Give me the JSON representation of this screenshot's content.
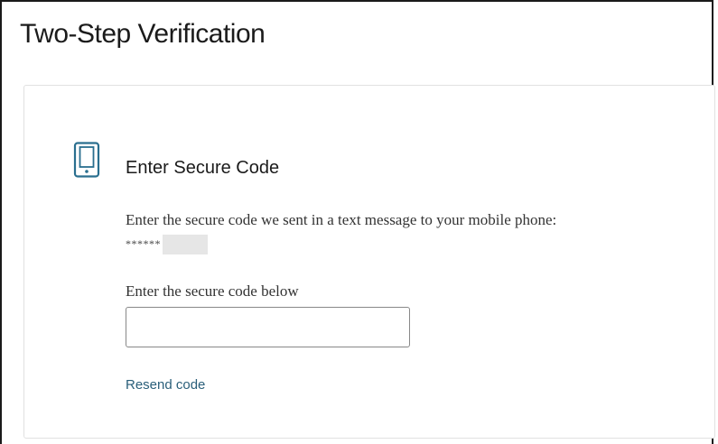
{
  "page": {
    "title": "Two-Step Verification"
  },
  "card": {
    "icon": "mobile-phone-icon",
    "heading": "Enter Secure Code",
    "instructions_text": "Enter the secure code we sent in a text message to your mobile phone:",
    "masked_phone": "******",
    "code_field_label": "Enter the secure code below",
    "code_field_value": "",
    "resend_label": "Resend code"
  },
  "colors": {
    "icon": "#2a6f8f",
    "link": "#2a5f7a",
    "text": "#333333",
    "title": "#1b1b1b"
  }
}
